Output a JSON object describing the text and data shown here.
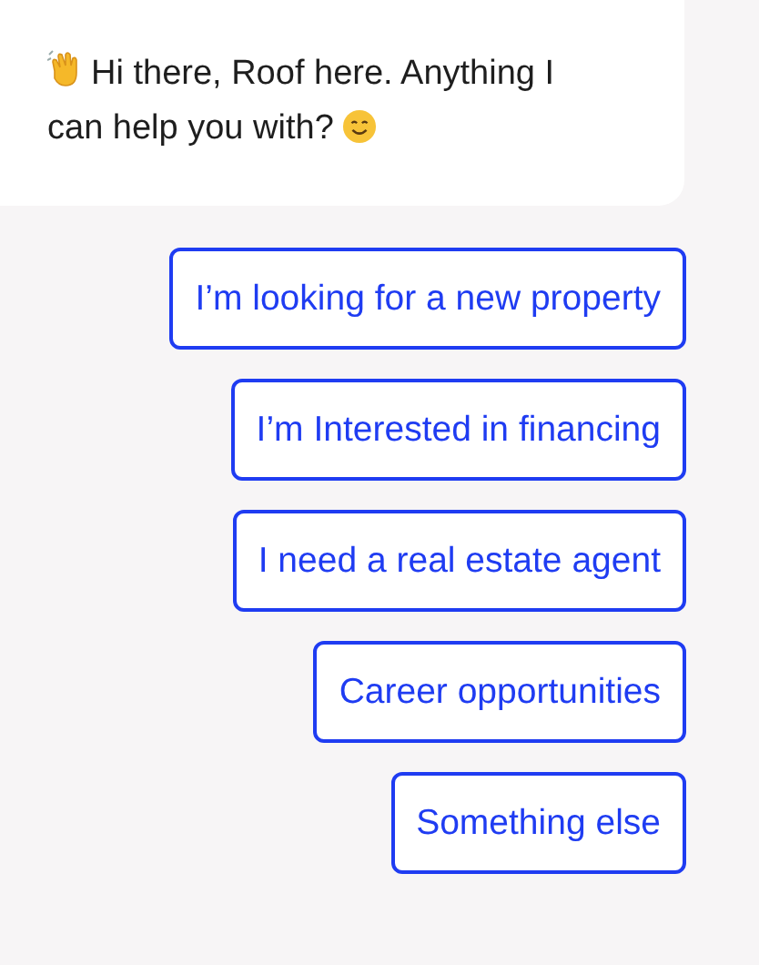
{
  "message": {
    "lines": [
      "Hi there, Roof here. Anything I",
      "can help you with?"
    ]
  },
  "quick_replies": [
    {
      "label": "I’m looking for a new property"
    },
    {
      "label": "I’m Interested in financing"
    },
    {
      "label": "I need a real estate agent"
    },
    {
      "label": "Career opportunities"
    },
    {
      "label": "Something else"
    }
  ]
}
